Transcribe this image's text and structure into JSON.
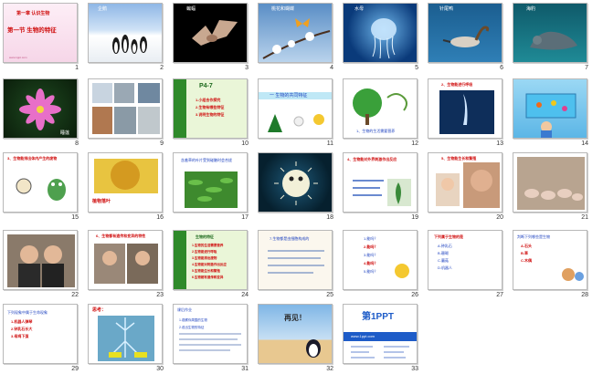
{
  "slides": [
    {
      "n": "1",
      "title": "第一章 认识生物",
      "subtitle": "第一节  生物的特征",
      "footer": "www.1ppt.com"
    },
    {
      "n": "2",
      "label": "企鹅"
    },
    {
      "n": "3",
      "label": "蝙蝠"
    },
    {
      "n": "4",
      "label": "桃花和蝴蝶"
    },
    {
      "n": "5",
      "label": "水母"
    },
    {
      "n": "6",
      "label": "针尾鸭"
    },
    {
      "n": "7",
      "label": "海豹"
    },
    {
      "n": "8",
      "label": "睡莲"
    },
    {
      "n": "9"
    },
    {
      "n": "10",
      "text": "P4-7",
      "lines": [
        "1.小组合作探究",
        "2.生物有哪些特征",
        "3.说明生物的特征"
      ]
    },
    {
      "n": "11",
      "title": "一 生物的共同特征"
    },
    {
      "n": "12",
      "title": "1、生物的生活需要营养"
    },
    {
      "n": "13",
      "title": "2、生物能进行呼吸"
    },
    {
      "n": "14"
    },
    {
      "n": "15",
      "title": "3、生物能排出体内产生的废物"
    },
    {
      "n": "16",
      "caption": "植物落叶"
    },
    {
      "n": "17",
      "title": "含羞草的叶片受到碰触时会合拢"
    },
    {
      "n": "18"
    },
    {
      "n": "19",
      "title": "4、生物能对外界刺激作出反应"
    },
    {
      "n": "20",
      "title": "5、生物能生长和繁殖"
    },
    {
      "n": "21"
    },
    {
      "n": "22"
    },
    {
      "n": "23",
      "title": "6、生物都有遗传和变异的特性"
    },
    {
      "n": "24",
      "lines": [
        "生物的特征",
        "1.生物的生活需要营养",
        "2.生物能进行呼吸",
        "3.生物能排出废物",
        "4.生物能对刺激作出反应",
        "5.生物能生长和繁殖",
        "6.生物都有遗传和变异"
      ]
    },
    {
      "n": "25",
      "title": "7.生物都是由细胞构成的"
    },
    {
      "n": "26",
      "lines": [
        "1.能吗？",
        "2.能吗？",
        "3.能吗？",
        "4.能吗？",
        "5.能吗？"
      ]
    },
    {
      "n": "27",
      "lines": [
        "下列属于生物的是",
        "A.钟乳石",
        "B.珊瑚",
        "C.蘑菇",
        "D.机器人"
      ]
    },
    {
      "n": "28",
      "lines": [
        "判断下列哪些是生物",
        "A.石头",
        "B.草",
        "C.木偶"
      ]
    },
    {
      "n": "29",
      "lines": [
        "下列现象中属于生命现象",
        "1.机器人弹琴",
        "2.钟乳石长大",
        "3.母鸡下蛋"
      ]
    },
    {
      "n": "30",
      "title": "思考："
    },
    {
      "n": "31",
      "title": "课后作业",
      "lines": [
        "1.观察你周围的生物",
        "2.说出生物的特征"
      ]
    },
    {
      "n": "32",
      "text": "再见！"
    },
    {
      "n": "33",
      "brand": "第1PPT",
      "sub": "www.1ppt.com"
    }
  ]
}
